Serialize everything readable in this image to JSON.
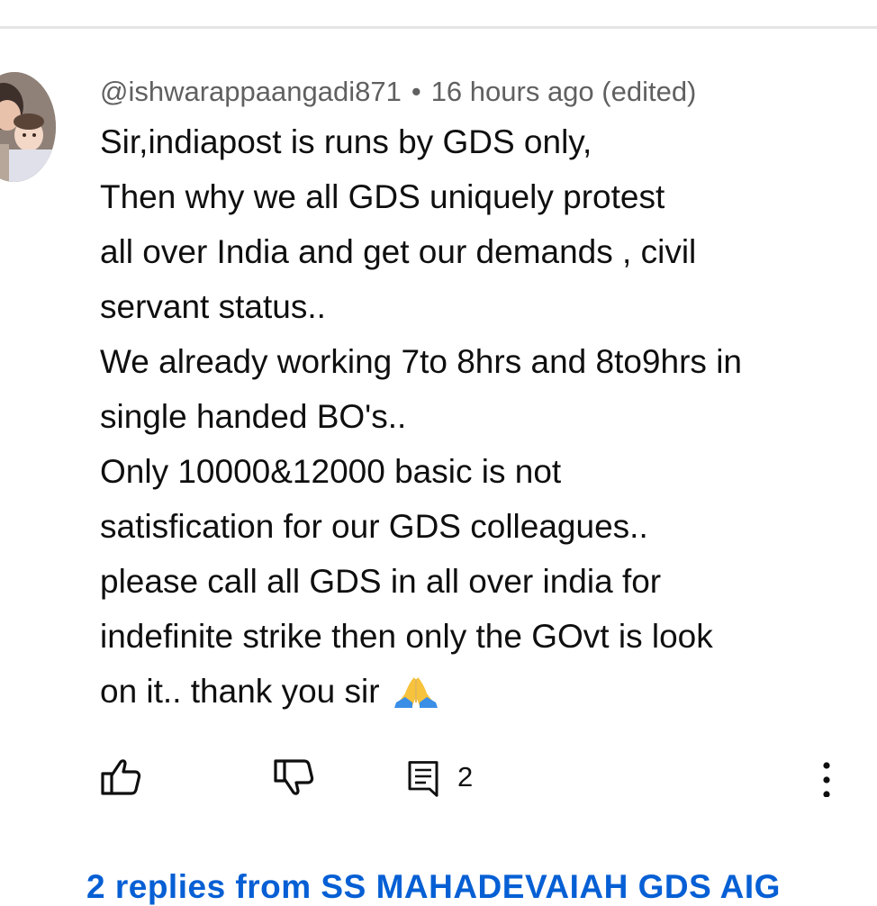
{
  "comment": {
    "author": "@ishwarappaangadi871",
    "separator": "•",
    "time": "16 hours ago (edited)",
    "lines": [
      "Sir,indiapost is runs by GDS only,",
      "Then why we all GDS uniquely protest",
      "all over India and get our demands , civil",
      "servant status..",
      "We already working 7to 8hrs and 8to9hrs in",
      "single handed BO's..",
      "Only 10000&12000 basic is not",
      "satisfication for our GDS colleagues..",
      "please call all GDS in all over india for",
      "indefinite strike then only the GOvt is look",
      "on it.. thank you sir"
    ],
    "emoji": "🙏"
  },
  "actions": {
    "reply_count": "2"
  },
  "replies_link": "2 replies from SS MAHADEVAIAH GDS AIG"
}
